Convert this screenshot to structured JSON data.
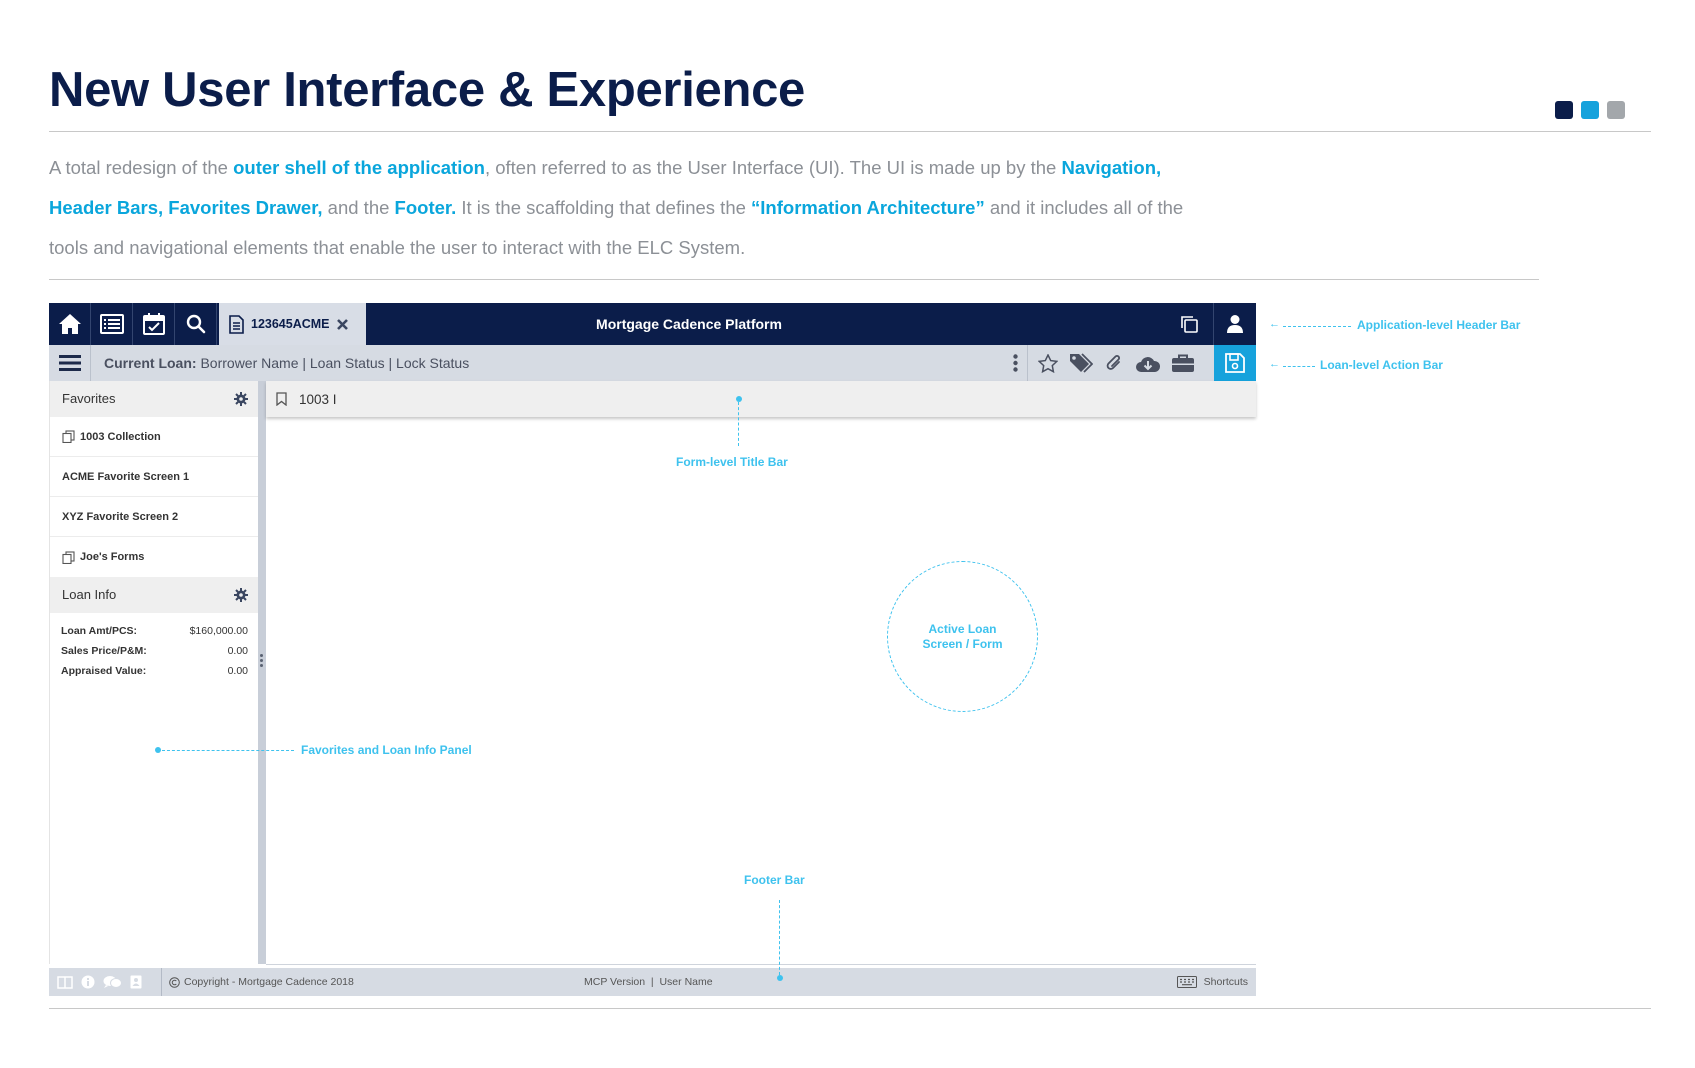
{
  "slide": {
    "title": "New User Interface & Experience",
    "intro": {
      "p1": "A total redesign of the ",
      "h1": "outer shell of the application",
      "p2": ", often referred to as the User Interface (UI). The UI is made up by the ",
      "h2": "Navigation, Header Bars, Favorites Drawer,",
      "p3": " and the ",
      "h3": "Footer.",
      "p4": " It is the scaffolding that defines the ",
      "h4": "“Information Architecture”",
      "p5": " and it includes all of the tools and navigational elements that enable the user to interact with the ELC System."
    },
    "dot_colors": [
      "#0b1d4a",
      "#16a2dc",
      "#a3a7ab"
    ]
  },
  "app": {
    "header": {
      "loan_tab": "123645ACME",
      "title": "Mortgage Cadence Platform"
    },
    "action_bar": {
      "label": "Current Loan:",
      "value": "Borrower Name | Loan Status | Lock Status"
    },
    "favorites": {
      "heading": "Favorites",
      "items": [
        "1003 Collection",
        "ACME Favorite Screen 1",
        "XYZ Favorite Screen 2",
        "Joe's Forms"
      ]
    },
    "loan_info": {
      "heading": "Loan Info",
      "rows": [
        {
          "label": "Loan Amt/PCS:",
          "value": "$160,000.00"
        },
        {
          "label": "Sales Price/P&M:",
          "value": "0.00"
        },
        {
          "label": "Appraised Value:",
          "value": "0.00"
        }
      ]
    },
    "form_title": "1003 I",
    "footer": {
      "copyright": "Copyright - Mortgage Cadence 2018",
      "version": "MCP Version  |  User Name",
      "shortcuts": "Shortcuts"
    }
  },
  "annotations": {
    "app_header": "Application-level Header Bar",
    "action_bar": "Loan-level Action Bar",
    "form_title_bar": "Form-level Title Bar",
    "active_screen_line1": "Active Loan",
    "active_screen_line2": "Screen / Form",
    "left_panel": "Favorites and Loan Info Panel",
    "footer_bar": "Footer Bar"
  },
  "colors": {
    "navy": "#0b1d4a",
    "accent": "#16a2dc",
    "annotation": "#3ec2ee",
    "action_bar_bg": "#d6dbe3"
  }
}
